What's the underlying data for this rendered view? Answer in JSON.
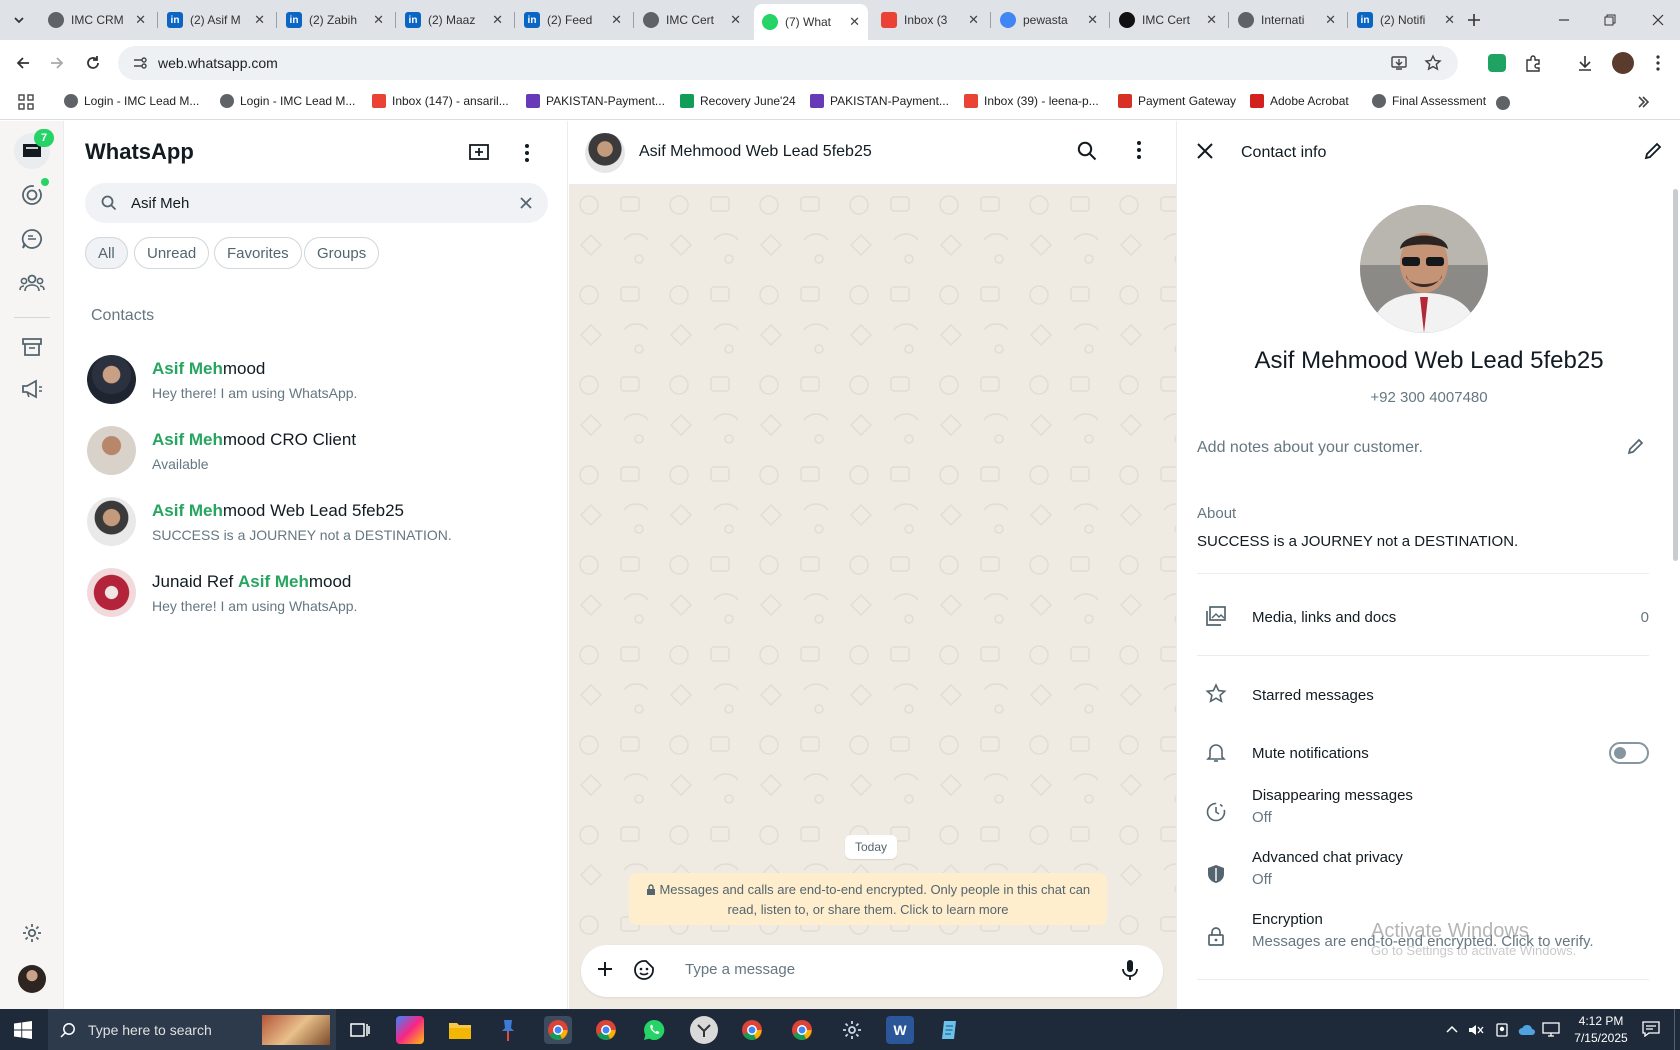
{
  "browser": {
    "tabs": [
      {
        "title": "IMC CRM",
        "icon": "imc-logo-icon",
        "color": "#5f6368"
      },
      {
        "title": "(2) Asif M",
        "icon": "linkedin-icon",
        "color": "#0a66c2"
      },
      {
        "title": "(2) Zabih",
        "icon": "linkedin-icon",
        "color": "#0a66c2"
      },
      {
        "title": "(2) Maaz",
        "icon": "linkedin-icon",
        "color": "#0a66c2"
      },
      {
        "title": "(2) Feed",
        "icon": "linkedin-icon",
        "color": "#0a66c2"
      },
      {
        "title": "IMC Cert",
        "icon": "imc-logo-icon",
        "color": "#5f6368"
      },
      {
        "title": "(7) What",
        "icon": "whatsapp-icon",
        "color": "#25d366"
      },
      {
        "title": "Inbox (3",
        "icon": "gmail-icon",
        "color": "#ea4335"
      },
      {
        "title": "pewasta",
        "icon": "google-icon",
        "color": "#4285f4"
      },
      {
        "title": "IMC Cert",
        "icon": "threads-icon",
        "color": "#111111"
      },
      {
        "title": "Internati",
        "icon": "imc-logo-icon",
        "color": "#5f6368"
      },
      {
        "title": "(2) Notifi",
        "icon": "linkedin-icon",
        "color": "#0a66c2"
      }
    ],
    "active_tab_index": 6,
    "url": "web.whatsapp.com",
    "bookmarks": [
      {
        "label": "Login - IMC Lead M...",
        "icon": "imc-logo-icon",
        "color": "#5f6368"
      },
      {
        "label": "Login - IMC Lead M...",
        "icon": "imc-logo-icon",
        "color": "#5f6368"
      },
      {
        "label": "Inbox (147) - ansaril...",
        "icon": "gmail-icon",
        "color": "#ea4335"
      },
      {
        "label": "PAKISTAN-Payment...",
        "icon": "forms-icon",
        "color": "#673ab7"
      },
      {
        "label": "Recovery June'24",
        "icon": "sheets-icon",
        "color": "#0f9d58"
      },
      {
        "label": "PAKISTAN-Payment...",
        "icon": "forms-icon",
        "color": "#673ab7"
      },
      {
        "label": "Inbox (39) - leena-p...",
        "icon": "gmail-icon",
        "color": "#ea4335"
      },
      {
        "label": "Payment Gateway",
        "icon": "gateway-icon",
        "color": "#d93025"
      },
      {
        "label": "Adobe Acrobat",
        "icon": "acrobat-icon",
        "color": "#d3211f"
      },
      {
        "label": "Final Assessment",
        "icon": "imc-logo-icon",
        "color": "#5f6368"
      }
    ]
  },
  "whatsapp": {
    "brand": "WhatsApp",
    "unread_badge": "7",
    "search_value": "Asif Meh",
    "filters": [
      "All",
      "Unread",
      "Favorites",
      "Groups"
    ],
    "section_label": "Contacts",
    "contacts": [
      {
        "pre": "",
        "match": "Asif Meh",
        "post": "mood",
        "status": "Hey there! I am using WhatsApp."
      },
      {
        "pre": "",
        "match": "Asif Meh",
        "post": "mood CRO Client",
        "status": "Available"
      },
      {
        "pre": "",
        "match": "Asif Meh",
        "post": "mood Web Lead 5feb25",
        "status": "SUCCESS is a JOURNEY not a DESTINATION."
      },
      {
        "pre": "Junaid Ref ",
        "match": "Asif Meh",
        "post": "mood",
        "status": "Hey there! I am using WhatsApp."
      }
    ],
    "chat": {
      "title": "Asif Mehmood Web Lead 5feb25",
      "date_chip": "Today",
      "encryption_notice": "Messages and calls are end-to-end encrypted. Only people in this chat can read, listen to, or share them. Click to learn more",
      "composer_placeholder": "Type a message"
    },
    "contact_info": {
      "header": "Contact info",
      "name": "Asif Mehmood Web Lead 5feb25",
      "phone": "+92 300 4007480",
      "notes_placeholder": "Add notes about your customer.",
      "about_label": "About",
      "about_text": "SUCCESS is a JOURNEY not a DESTINATION.",
      "media_label": "Media, links and docs",
      "media_count": "0",
      "starred_label": "Starred messages",
      "mute_label": "Mute notifications",
      "mute_on": false,
      "disappearing_label": "Disappearing messages",
      "disappearing_value": "Off",
      "privacy_label": "Advanced chat privacy",
      "privacy_value": "Off",
      "encryption_label": "Encryption",
      "encryption_value": "Messages are end-to-end encrypted. Click to verify."
    },
    "watermark": {
      "title": "Activate Windows",
      "subtitle": "Go to Settings to activate Windows."
    }
  },
  "taskbar": {
    "search_placeholder": "Type here to search",
    "time": "4:12 PM",
    "date": "7/15/2025"
  },
  "colors": {
    "accent": "#25a55f",
    "unread_badge": "#25d366",
    "taskbar": "#1e2a3a"
  }
}
